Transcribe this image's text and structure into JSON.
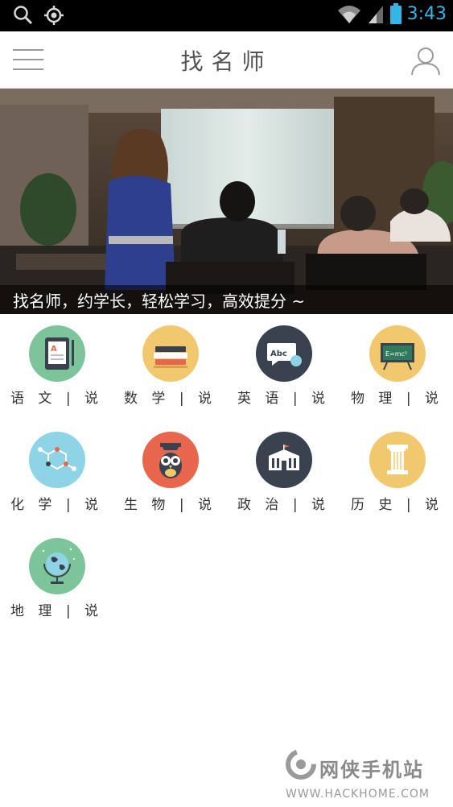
{
  "status_bar": {
    "time": "3:43"
  },
  "header": {
    "title": "找名师"
  },
  "banner": {
    "caption": "找名师，约学长，轻松学习，高效提分 ~"
  },
  "subjects": [
    {
      "label": "语 文 | 说",
      "icon": "tablet-book-icon",
      "color": "#7cc59a"
    },
    {
      "label": "数 学 | 说",
      "icon": "books-stack-icon",
      "color": "#f2c86e"
    },
    {
      "label": "英 语 | 说",
      "icon": "abc-speech-bubble-icon",
      "color": "#39424e"
    },
    {
      "label": "物 理 | 说",
      "icon": "blackboard-emc2-icon",
      "color": "#f2c86e"
    },
    {
      "label": "化 学 | 说",
      "icon": "molecule-icon",
      "color": "#8ed3e6"
    },
    {
      "label": "生 物 | 说",
      "icon": "owl-icon",
      "color": "#e8664b"
    },
    {
      "label": "政 治 | 说",
      "icon": "government-building-icon",
      "color": "#39424e"
    },
    {
      "label": "历 史 | 说",
      "icon": "column-pillar-icon",
      "color": "#f2c86e"
    },
    {
      "label": "地 理 | 说",
      "icon": "globe-icon",
      "color": "#7cc59a"
    }
  ],
  "watermark": {
    "name": "网侠手机站",
    "url": "WWW.HACKHOME.COM"
  }
}
